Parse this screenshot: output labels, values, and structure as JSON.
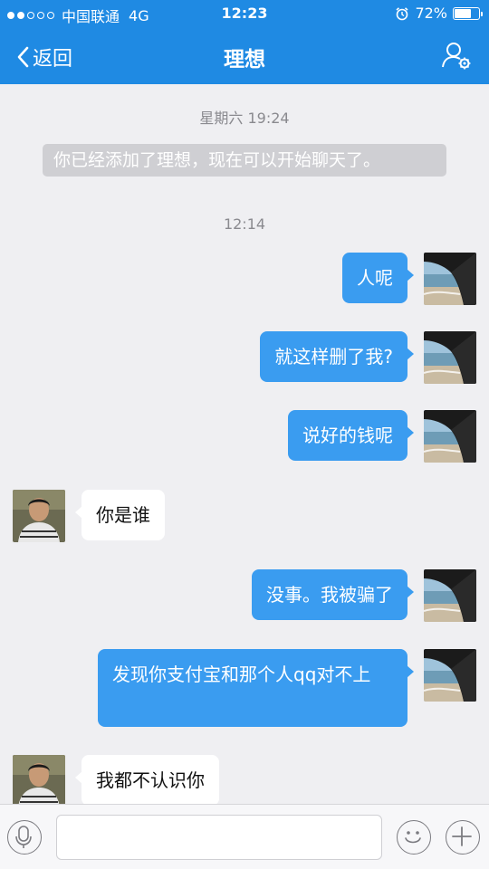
{
  "status_bar": {
    "carrier": "中国联通",
    "network": "4G",
    "time": "12:23",
    "battery_text": "72%",
    "battery_level": 0.72
  },
  "nav": {
    "back_label": "返回",
    "title": "理想"
  },
  "chat": {
    "timestamp_1": "星期六 19:24",
    "system_message": "你已经添加了理想，现在可以开始聊天了。",
    "timestamp_2": "12:14",
    "messages": [
      {
        "side": "out",
        "text": "人呢"
      },
      {
        "side": "out",
        "text": "就这样删了我?"
      },
      {
        "side": "out",
        "text": "说好的钱呢"
      },
      {
        "side": "in",
        "text": "你是谁"
      },
      {
        "side": "out",
        "text": "没事。我被骗了"
      },
      {
        "side": "out",
        "text": "发现你支付宝和那个人qq对不上"
      },
      {
        "side": "in",
        "text": "我都不认识你"
      }
    ]
  },
  "input_bar": {
    "message_value": "",
    "icons": [
      "voice-icon",
      "emoji-icon",
      "plus-icon"
    ]
  },
  "colors": {
    "nav_bar": "#1f8ae3",
    "outgoing_bubble": "#3a9cf0",
    "incoming_bubble": "#ffffff",
    "background": "#efeff2"
  }
}
